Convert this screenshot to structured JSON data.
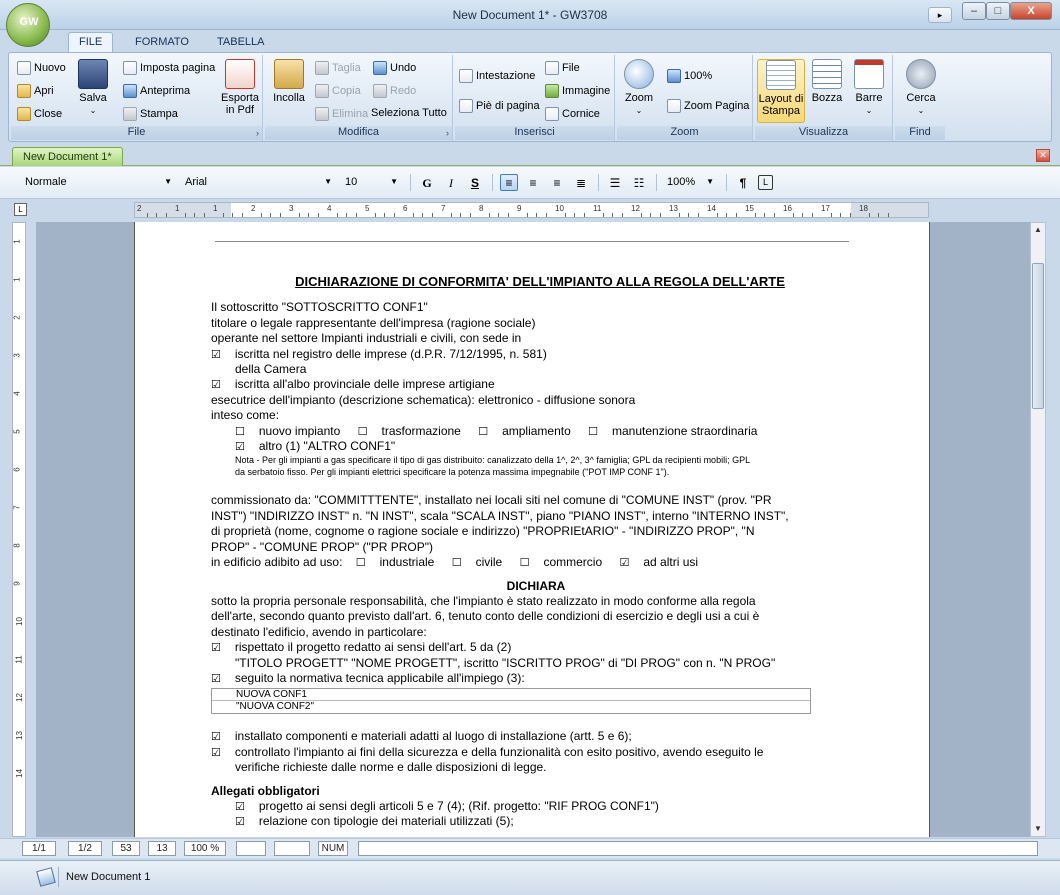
{
  "window": {
    "title": "New Document 1* - GW3708",
    "logo_text": "GW",
    "minimize": "–",
    "maximize": "□",
    "close": "X",
    "quick_access": "▸"
  },
  "ribbon_tabs": [
    "FILE",
    "FORMATO",
    "TABELLA"
  ],
  "ribbon": {
    "file": {
      "label": "File",
      "nuovo": "Nuovo",
      "apri": "Apri",
      "close": "Close",
      "salva": "Salva",
      "imposta_pagina": "Imposta pagina",
      "anteprima": "Anteprima",
      "stampa": "Stampa",
      "esporta": "Esporta in Pdf"
    },
    "modifica": {
      "label": "Modifica",
      "incolla": "Incolla",
      "taglia": "Taglia",
      "copia": "Copia",
      "elimina": "Elimina",
      "undo": "Undo",
      "redo": "Redo",
      "seleziona_tutto": "Seleziona Tutto"
    },
    "inserisci": {
      "label": "Inserisci",
      "intestazione": "Intestazione",
      "pie_di_pagina": "Piè di pagina",
      "file": "File",
      "immagine": "Immagine",
      "cornice": "Cornice"
    },
    "zoom": {
      "label": "Zoom",
      "zoom": "Zoom",
      "cento": "100%",
      "zoom_pagina": "Zoom Pagina"
    },
    "visualizza": {
      "label": "Visualizza",
      "layout": "Layout di Stampa",
      "bozza": "Bozza",
      "barre": "Barre"
    },
    "find": {
      "label": "Find",
      "cerca": "Cerca"
    }
  },
  "document_tab": {
    "label": "New Document 1*"
  },
  "format_bar": {
    "style": "Normale",
    "font": "Arial",
    "size": "10",
    "bold": "G",
    "italic": "I",
    "strike": "S",
    "zoom": "100%",
    "pilcrow": "¶"
  },
  "ruler": {
    "numbers": [
      "2",
      "1",
      "1",
      "2",
      "3",
      "4",
      "5",
      "6",
      "7",
      "8",
      "9",
      "10",
      "11",
      "12",
      "13",
      "14",
      "15",
      "16",
      "17",
      "18"
    ]
  },
  "vruler": {
    "numbers": [
      "1",
      "1",
      "2",
      "3",
      "4",
      "5",
      "6",
      "7",
      "8",
      "9",
      "10",
      "11",
      "12",
      "13",
      "14"
    ]
  },
  "document": {
    "title": "DICHIARAZIONE DI CONFORMITA' DELL'IMPIANTO ALLA REGOLA DELL'ARTE",
    "p1": "Il sottoscritto \"SOTTOSCRITTO CONF1\"",
    "p2": "titolare o legale rappresentante dell'impresa (ragione sociale)",
    "p3": "operante nel settore Impianti industriali e civili, con sede in",
    "p4": "iscritta nel registro delle imprese (d.P.R. 7/12/1995, n. 581)",
    "p5": "della Camera",
    "p6": "iscritta all'albo provinciale delle imprese artigiane",
    "p7": "esecutrice dell'impianto (descrizione schematica): elettronico -  diffusione sonora",
    "p8": "inteso come:",
    "opt_nuovo": "nuovo impianto",
    "opt_trasf": "trasformazione",
    "opt_ampl": "ampliamento",
    "opt_manut": "manutenzione straordinaria",
    "altro": "altro (1) \"ALTRO CONF1\"",
    "nota1": "Nota - Per gli impianti a gas specificare il tipo di gas distribuito: canalizzato della 1^, 2^, 3^ famiglia; GPL da recipienti mobili; GPL",
    "nota2": "da serbatoio fisso. Per gli impianti elettrici specificare la potenza massima impegnabile (\"POT IMP CONF 1\").",
    "comm1": "commissionato da: \"COMMITTTENTE\", installato nei locali siti nel comune di \"COMUNE INST\" (prov. \"PR",
    "comm2": "INST\") \"INDIRIZZO INST\" n. \"N INST\", scala \"SCALA INST\", piano \"PIANO INST\", interno \"INTERNO INST\",",
    "comm3": "di proprietà (nome, cognome o ragione sociale e indirizzo) \"PROPRIEtARIO\" - \"INDIRIZZO PROP\", \"N",
    "comm4": "PROP\" - \"COMUNE PROP\" (\"PR PROP\")",
    "edificio": "in edificio adibito ad uso:",
    "opt_ind": "industriale",
    "opt_civ": "civile",
    "opt_comm": "commercio",
    "opt_altri": "ad altri usi",
    "dichiara": "DICHIARA",
    "d1": "sotto la propria personale responsabilità, che l'impianto è stato realizzato in modo conforme alla regola",
    "d2": "dell'arte, secondo quanto previsto dall'art. 6, tenuto conto delle condizioni di esercizio e degli usi a cui è",
    "d3": "destinato l'edificio, avendo in particolare:",
    "r1": "rispettato il progetto redatto ai sensi dell'art. 5 da (2)",
    "r2": "\"TITOLO PROGETT\" \"NOME PROGETT\", iscritto \"ISCRITTO PROG\" di \"DI PROG\" con n. \"N PROG\"",
    "r3": "seguito la normativa tecnica applicabile all'impiego (3):",
    "norm1": "NUOVA CONF1",
    "norm2": "\"NUOVA CONF2\"",
    "r4": "installato componenti e materiali adatti al luogo di installazione (artt. 5 e 6);",
    "r5": "controllato l'impianto ai fini della sicurezza e della funzionalità con esito positivo, avendo eseguito le",
    "r6": "verifiche richieste dalle norme e dalle disposizioni di legge.",
    "allegati": "Allegati obbligatori",
    "a1": "progetto ai sensi degli articoli 5 e 7 (4); (Rif. progetto: \"RIF PROG CONF1\")",
    "a2": "relazione con tipologie dei materiali utilizzati (5);"
  },
  "status_bar": {
    "page": "1/1",
    "section": "1/2",
    "line": "53",
    "col": "13",
    "zoom": "100 %",
    "num": "NUM"
  },
  "taskbar": {
    "label": "New Document 1"
  }
}
